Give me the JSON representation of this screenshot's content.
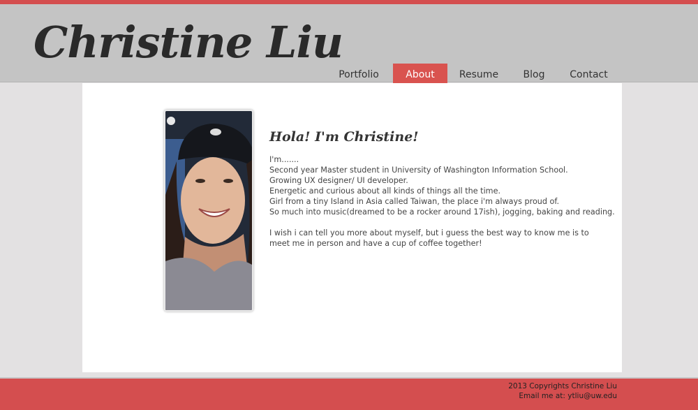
{
  "site": {
    "title": "Christine Liu"
  },
  "nav": {
    "items": [
      {
        "label": "Portfolio",
        "active": false
      },
      {
        "label": "About",
        "active": true
      },
      {
        "label": "Resume",
        "active": false
      },
      {
        "label": "Blog",
        "active": false
      },
      {
        "label": "Contact",
        "active": false
      }
    ]
  },
  "about": {
    "greeting": "Hola! I'm Christine!",
    "lines": [
      "I'm.......",
      "Second year Master student in University of Washington Information School.",
      "Growing UX designer/ UI developer.",
      "Energetic and curious about all kinds of things all the time.",
      "Girl from a tiny Island in Asia called Taiwan, the place i'm always proud of.",
      "So much into music(dreamed to be a rocker around 17ish), jogging, baking and reading."
    ],
    "closing": "I wish i can tell you more about myself, but i guess the best way to know me is to meet me in person and have a cup of coffee together!"
  },
  "footer": {
    "copyright": "2013 Copyrights Christine Liu",
    "email": "Email me at: ytliu@uw.edu"
  },
  "colors": {
    "accent": "#d9534f",
    "header_bg": "#c4c4c4",
    "page_bg": "#e3e1e2"
  }
}
